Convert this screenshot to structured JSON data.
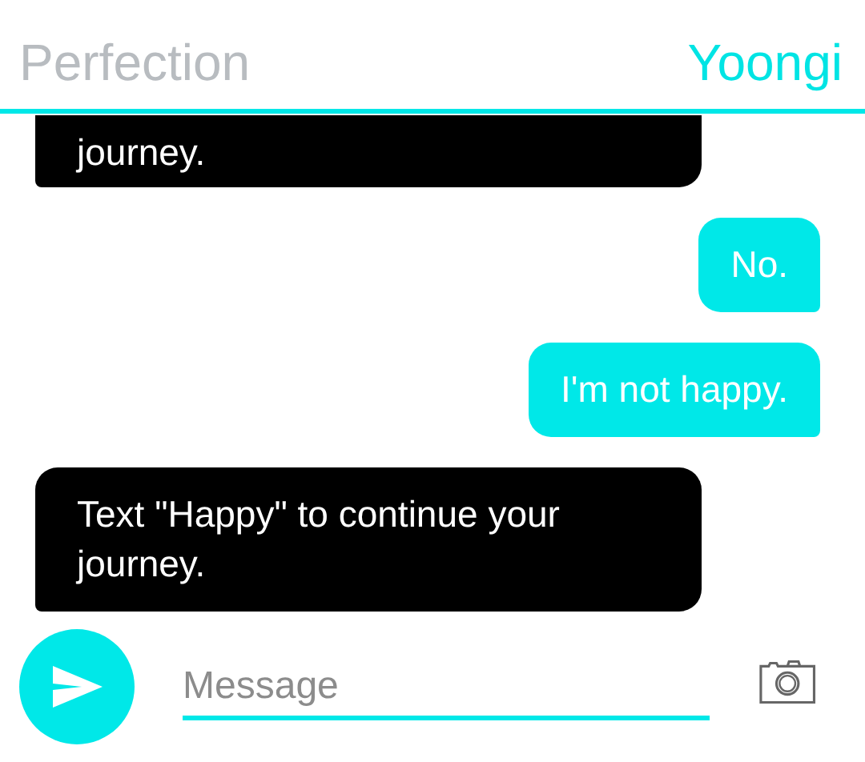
{
  "header": {
    "title": "Perfection",
    "contact": "Yoongi"
  },
  "messages": [
    {
      "kind": "received",
      "text": "journey."
    },
    {
      "kind": "sent",
      "text": "No."
    },
    {
      "kind": "sent",
      "text": "I'm not happy."
    },
    {
      "kind": "received",
      "text": "Text \"Happy\" to continue your journey."
    }
  ],
  "composer": {
    "placeholder": "Message"
  }
}
